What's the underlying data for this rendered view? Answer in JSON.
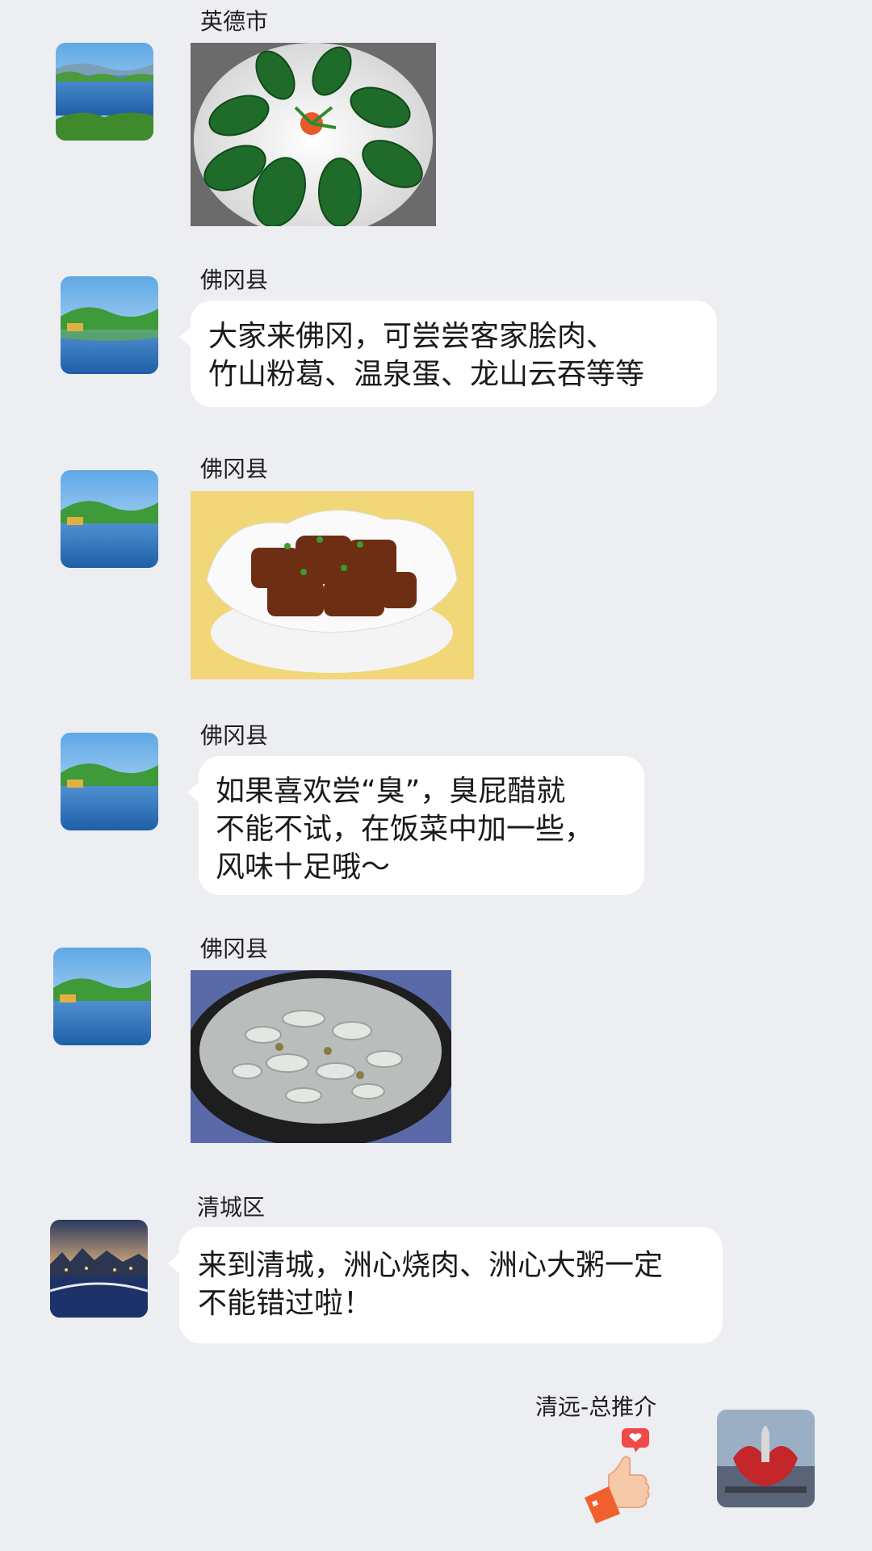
{
  "messages": [
    {
      "sender": "英德市",
      "type": "image",
      "image": "zongzi-leaf-rolls-photo"
    },
    {
      "sender": "佛冈县",
      "type": "text",
      "lines": [
        "大家来佛冈，可尝尝客家脍肉、",
        "竹山粉葛、温泉蛋、龙山云吞等等"
      ]
    },
    {
      "sender": "佛冈县",
      "type": "image",
      "image": "braised-pork-photo"
    },
    {
      "sender": "佛冈县",
      "type": "text",
      "lines": [
        "如果喜欢尝“臭”，臭屁醋就",
        "不能不试，在饭菜中加一些，",
        "风味十足哦～"
      ]
    },
    {
      "sender": "佛冈县",
      "type": "image",
      "image": "pork-soup-photo"
    },
    {
      "sender": "清城区",
      "type": "text",
      "lines": [
        "来到清城，洲心烧肉、洲心大粥一定",
        "不能错过啦！"
      ]
    }
  ],
  "self_message": {
    "sender": "清远-总推介",
    "sticker": "thumbs-up-heart-icon",
    "avatar": "red-lotus-sculpture-avatar"
  },
  "colors": {
    "background": "#eceef2",
    "bubble": "#ffffff",
    "text": "#1a1a1a"
  }
}
